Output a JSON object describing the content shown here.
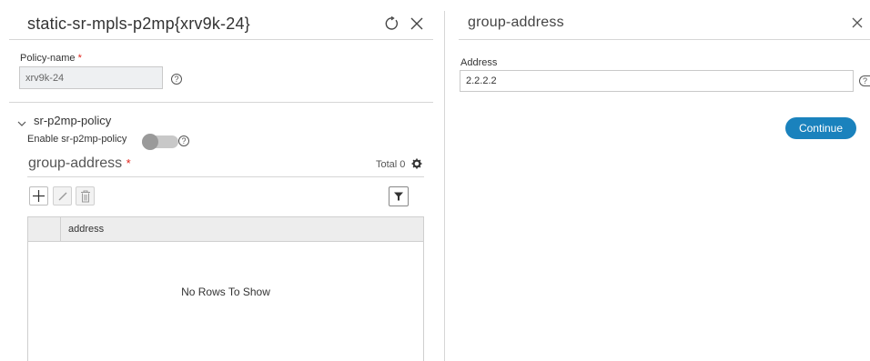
{
  "left_panel": {
    "title": "static-sr-mpls-p2mp{xrv9k-24}",
    "policy_name": {
      "label": "Policy-name",
      "required_mark": "*",
      "value": "xrv9k-24"
    },
    "section": {
      "title": "sr-p2mp-policy",
      "enable_label": "Enable sr-p2mp-policy",
      "enabled": false
    },
    "group": {
      "title": "group-address",
      "required_mark": "*",
      "total_label": "Total 0"
    },
    "grid": {
      "columns": [
        "address"
      ],
      "empty_text": "No Rows To Show"
    }
  },
  "right_panel": {
    "title": "group-address",
    "address": {
      "label": "Address",
      "value": "2.2.2.2"
    },
    "continue_label": "Continue"
  },
  "colors": {
    "accent": "#1a82bd",
    "required": "#e2231a"
  },
  "help_glyph": "?"
}
